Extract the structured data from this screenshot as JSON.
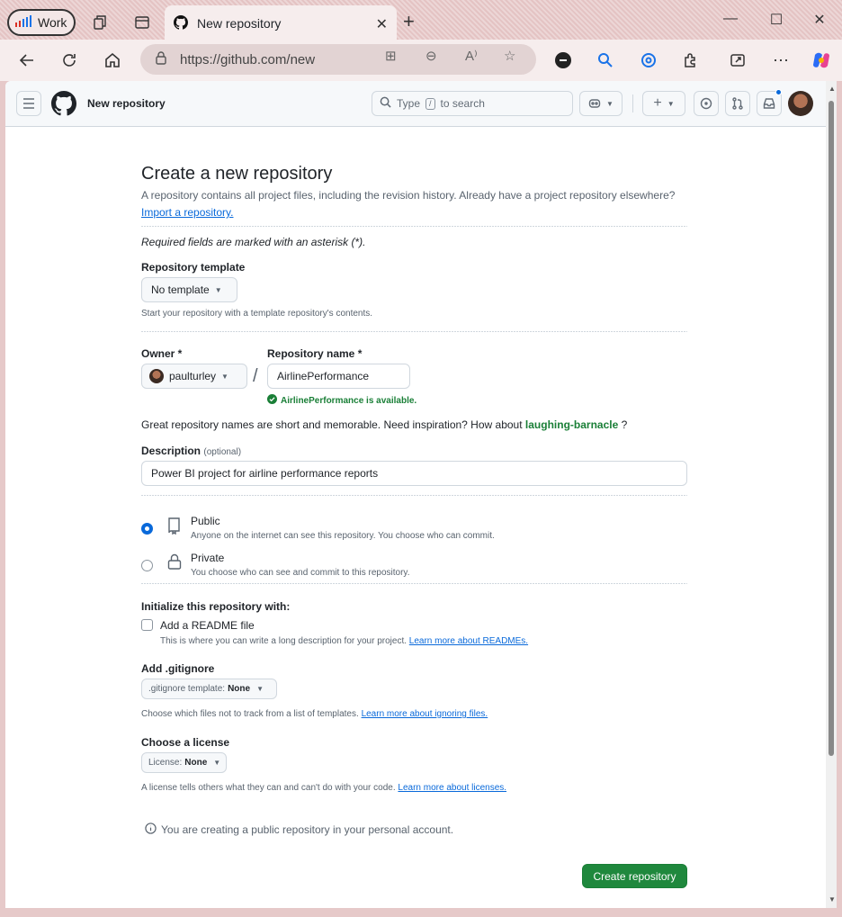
{
  "browser": {
    "profile_label": "Work",
    "tab_title": "New repository",
    "url": "https://github.com/new"
  },
  "header": {
    "title": "New repository",
    "search_prefix": "Type",
    "search_key": "/",
    "search_suffix": "to search"
  },
  "form": {
    "heading": "Create a new repository",
    "intro": "A repository contains all project files, including the revision history. Already have a project repository elsewhere?",
    "import_link": "Import a repository.",
    "required_note": "Required fields are marked with an asterisk (*).",
    "template": {
      "label": "Repository template",
      "value": "No template",
      "help": "Start your repository with a template repository's contents."
    },
    "owner": {
      "label": "Owner *",
      "value": "paulturley"
    },
    "separator": "/",
    "repo_name": {
      "label": "Repository name *",
      "value": "AirlinePerformance",
      "availability": "AirlinePerformance is available."
    },
    "suggestion_text": "Great repository names are short and memorable. Need inspiration? How about",
    "suggestion_name": "laughing-barnacle",
    "suggestion_end": "?",
    "description": {
      "label": "Description",
      "optional": "(optional)",
      "value": "Power BI project for airline performance reports"
    },
    "visibility": {
      "selected": "public",
      "public_label": "Public",
      "public_desc": "Anyone on the internet can see this repository. You choose who can commit.",
      "private_label": "Private",
      "private_desc": "You choose who can see and commit to this repository."
    },
    "init": {
      "heading": "Initialize this repository with:",
      "readme_label": "Add a README file",
      "readme_checked": false,
      "readme_desc": "This is where you can write a long description for your project.",
      "readme_link": "Learn more about READMEs."
    },
    "gitignore": {
      "label": "Add .gitignore",
      "prefix": ".gitignore template:",
      "value": "None",
      "help": "Choose which files not to track from a list of templates.",
      "link": "Learn more about ignoring files."
    },
    "license": {
      "label": "Choose a license",
      "prefix": "License:",
      "value": "None",
      "help": "A license tells others what they can and can't do with your code.",
      "link": "Learn more about licenses."
    },
    "info_note": "You are creating a public repository in your personal account.",
    "submit_label": "Create repository"
  },
  "colors": {
    "accent": "#0969da",
    "success": "#1a7f37",
    "primary_button": "#1f883d"
  }
}
